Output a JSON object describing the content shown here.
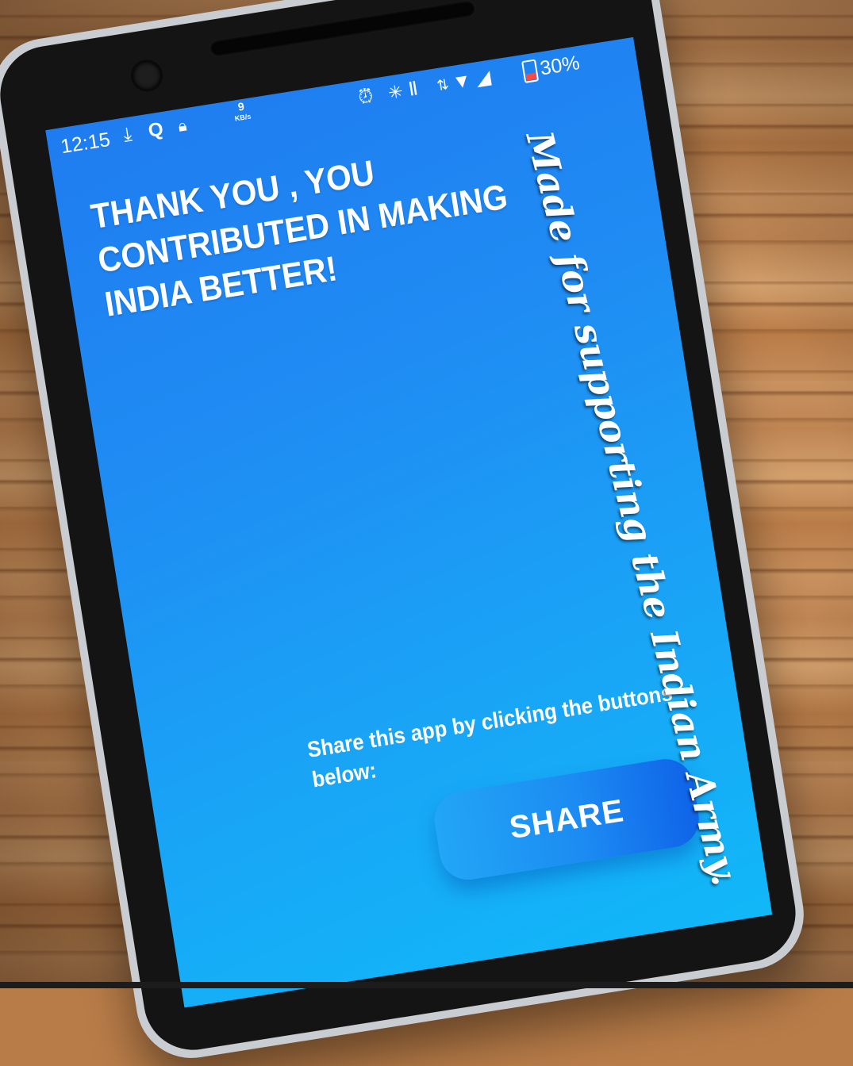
{
  "statusbar": {
    "time": "12:15",
    "net_speed_value": "9",
    "net_speed_unit": "KB/s",
    "battery_percent": "30%",
    "left_icons": [
      "download-icon",
      "q-app-icon",
      "wifi-lock-icon"
    ],
    "right_icons": [
      "alarm-icon",
      "bluetooth-icon",
      "vibrate-icon",
      "data-arrows-icon",
      "wifi-icon",
      "signal-icon",
      "battery-icon"
    ]
  },
  "app": {
    "headline": "THANK YOU , YOU CONTRIBUTED IN MAKING INDIA BETTER!",
    "share_prompt": "Share this app by clicking the buttons below:",
    "share_button_label": "SHARE",
    "background_colors": [
      "#1f7cf0",
      "#11b8f8"
    ]
  },
  "overlay": {
    "caption": "Made for supporting the Indian Army."
  }
}
